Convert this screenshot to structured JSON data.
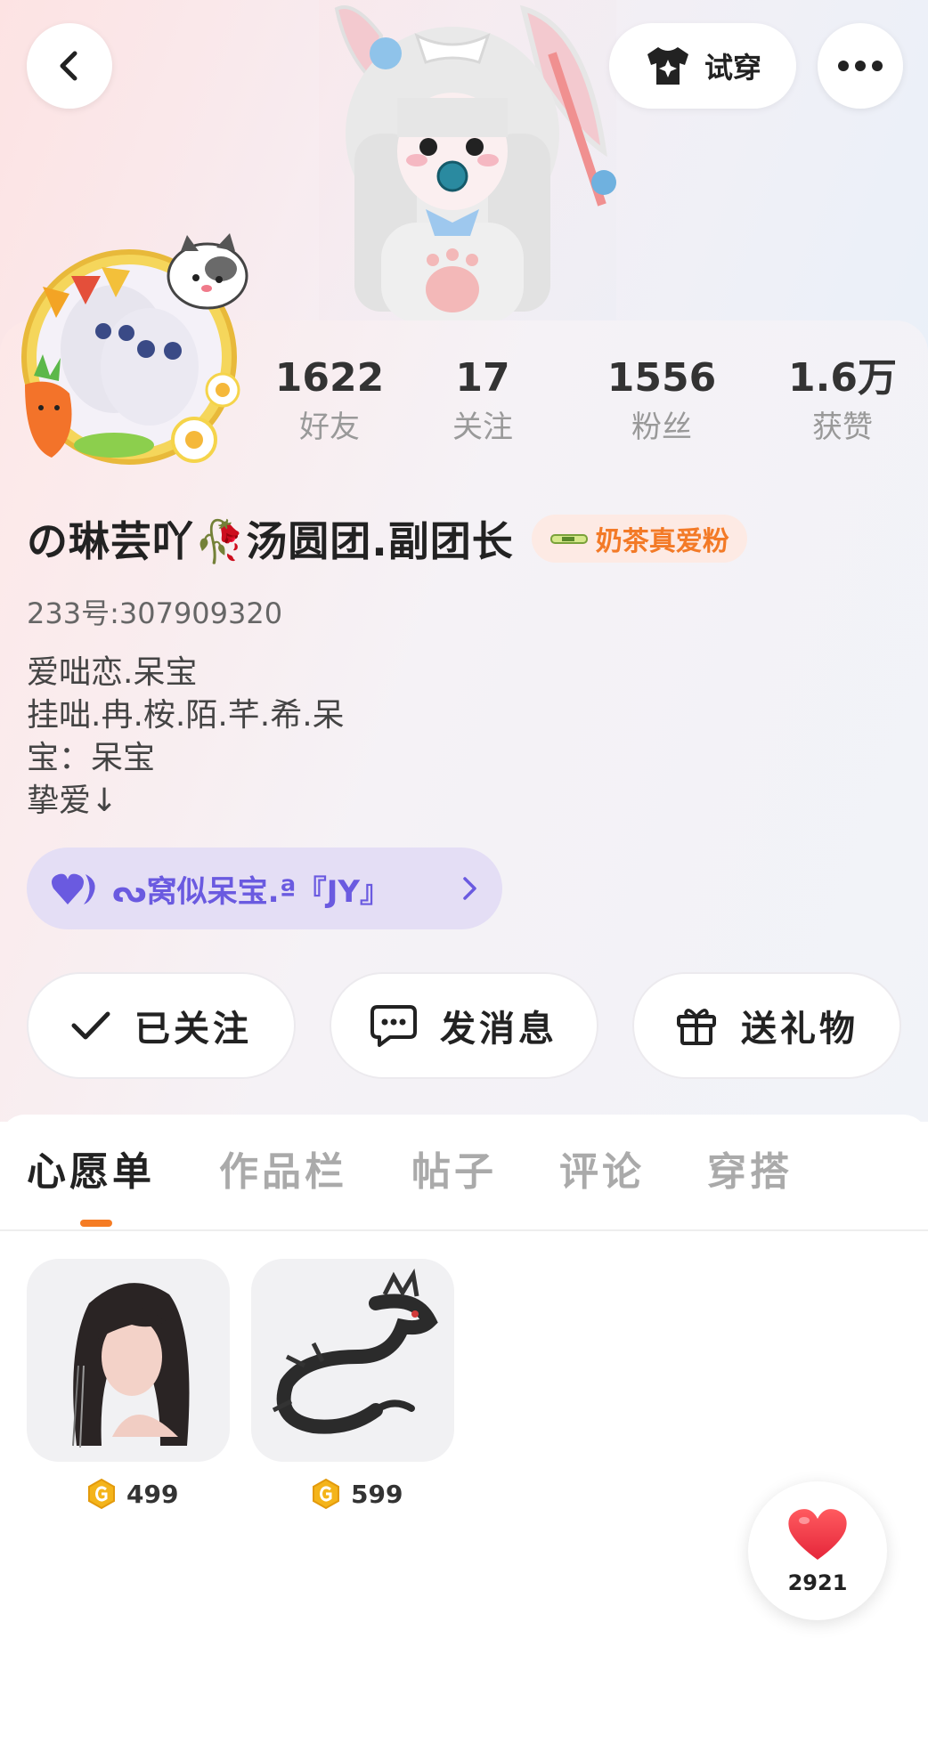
{
  "header": {
    "tryon_label": "试穿"
  },
  "stats": [
    {
      "value": "1622",
      "label": "好友"
    },
    {
      "value": "17",
      "label": "关注"
    },
    {
      "value": "1556",
      "label": "粉丝"
    },
    {
      "value": "1.6万",
      "label": "获赞"
    }
  ],
  "profile": {
    "name": "の琳芸吖🥀汤圆团.副团长",
    "badge": "奶茶真爱粉",
    "uid": "233号:307909320",
    "bio": [
      "爱咄恋.呆宝",
      "挂咄.冉.桉.陌.芊.希.呆",
      "宝：呆宝",
      "挚爱↓"
    ]
  },
  "group": {
    "label": "ᔓ窝似呆宝.ª『JY』"
  },
  "actions": {
    "follow": "已关注",
    "message": "发消息",
    "gift": "送礼物"
  },
  "tabs": [
    "心愿单",
    "作品栏",
    "帖子",
    "评论",
    "穿搭"
  ],
  "wishlist": [
    {
      "price": "499",
      "icon": "long-black-hair-item"
    },
    {
      "price": "599",
      "icon": "black-dragon-item"
    }
  ],
  "likes": {
    "count": "2921"
  },
  "colors": {
    "accent_orange": "#f57c24",
    "group_purple": "#6a5ae0",
    "heart_red": "#f03a4a"
  }
}
